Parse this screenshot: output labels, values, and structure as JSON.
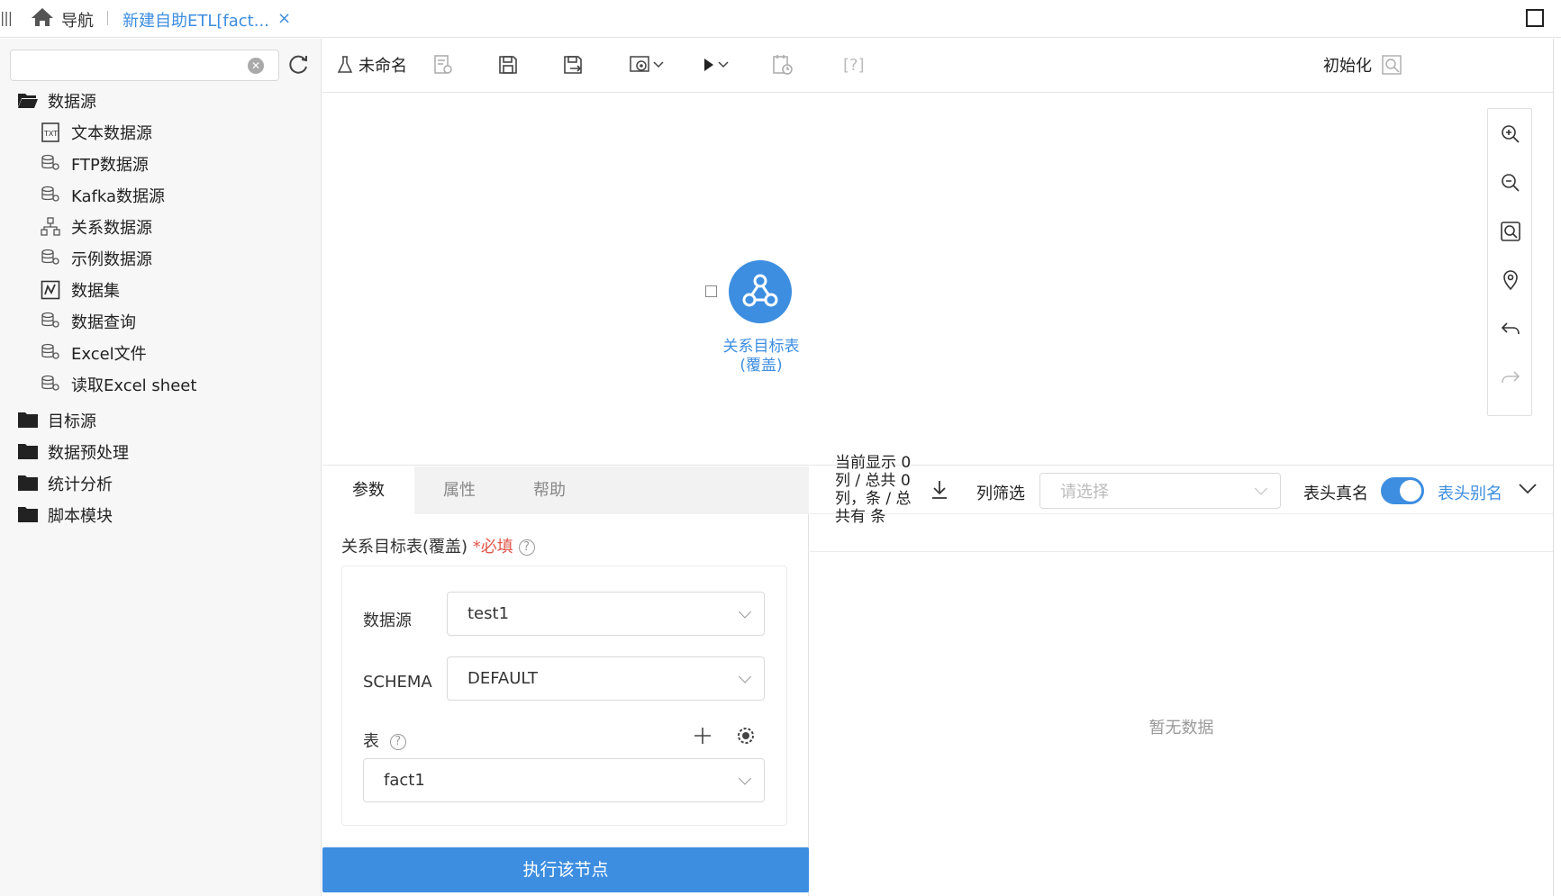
{
  "topbar": {
    "nav_label": "导航",
    "tab_label": "新建自助ETL[fact...",
    "close_glyph": "×"
  },
  "sidebar": {
    "search_placeholder": "",
    "folders": [
      {
        "label": "数据源",
        "icon": "folder-open-icon"
      },
      {
        "label": "目标源",
        "icon": "folder-icon"
      },
      {
        "label": "数据预处理",
        "icon": "folder-icon"
      },
      {
        "label": "统计分析",
        "icon": "folder-icon"
      },
      {
        "label": "脚本模块",
        "icon": "folder-icon"
      }
    ],
    "datasource_items": [
      {
        "label": "文本数据源",
        "icon": "text-file-icon"
      },
      {
        "label": "FTP数据源",
        "icon": "database-icon"
      },
      {
        "label": "Kafka数据源",
        "icon": "database-icon"
      },
      {
        "label": "关系数据源",
        "icon": "relation-icon"
      },
      {
        "label": "示例数据源",
        "icon": "database-icon"
      },
      {
        "label": "数据集",
        "icon": "dataset-icon"
      },
      {
        "label": "数据查询",
        "icon": "database-icon"
      },
      {
        "label": "Excel文件",
        "icon": "database-icon"
      },
      {
        "label": "读取Excel sheet",
        "icon": "database-icon"
      }
    ]
  },
  "toolbar": {
    "name_label": "未命名",
    "help_label": "[?]",
    "init_label": "初始化"
  },
  "canvas": {
    "node_label_line1": "关系目标表",
    "node_label_line2": "(覆盖)"
  },
  "params": {
    "tabs": [
      "参数",
      "属性",
      "帮助"
    ],
    "active_tab": "参数",
    "section_title": "关系目标表(覆盖)",
    "required_text": "*必填",
    "datasource_label": "数据源",
    "datasource_value": "test1",
    "schema_label": "SCHEMA",
    "schema_value": "DEFAULT",
    "table_label": "表",
    "table_value": "fact1",
    "execute_label": "执行该节点"
  },
  "preview": {
    "count_text": "当前显示 0 列 / 总共 0 列，条 / 总共有 条",
    "filter_label": "列筛选",
    "filter_placeholder": "请选择",
    "realname_label": "表头真名",
    "alias_label": "表头别名",
    "toggle_on": true,
    "empty_text": "暂无数据"
  },
  "colors": {
    "accent": "#3d8ee0",
    "required": "#e2574c"
  }
}
